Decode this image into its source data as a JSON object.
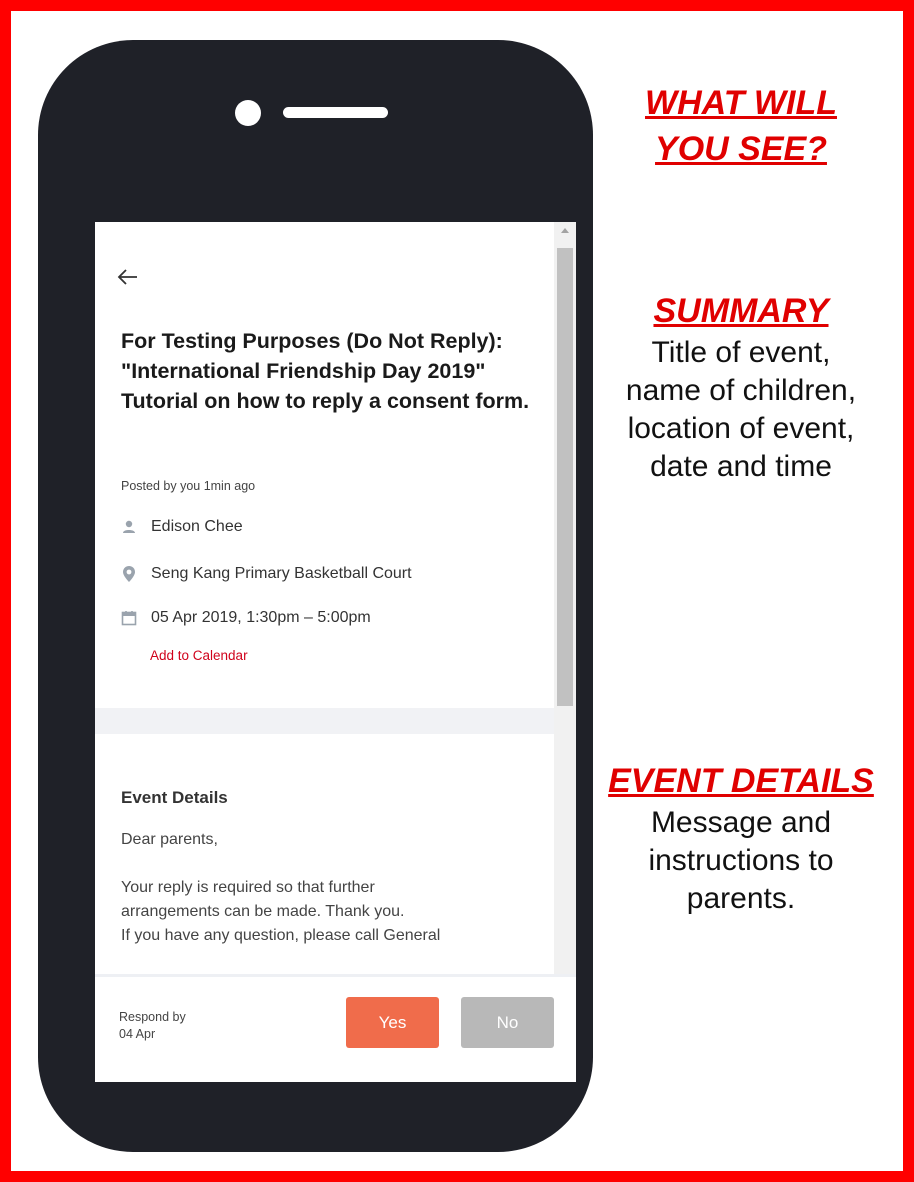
{
  "post": {
    "title": "For Testing Purposes (Do Not Reply): \"International Friendship Day 2019\" Tutorial on how to reply a consent form.",
    "posted": "Posted by you 1min ago",
    "child_name": "Edison Chee",
    "location": "Seng Kang Primary Basketball Court",
    "datetime": "05 Apr 2019, 1:30pm – 5:00pm",
    "add_to_calendar": "Add to Calendar"
  },
  "event_details": {
    "heading": "Event Details",
    "greeting": "Dear parents,",
    "line1": "Your reply is required so that further",
    "line2": "arrangements can be made. Thank you.",
    "line3": "If you have any question, please call General"
  },
  "footer": {
    "respond_label": "Respond by",
    "respond_date": "04 Apr",
    "yes_label": "Yes",
    "no_label": "No"
  },
  "annotations": {
    "intro_line1": "WHAT WILL",
    "intro_line2": "YOU SEE?",
    "summary_heading": "SUMMARY",
    "summary_l1": "Title of event,",
    "summary_l2": "name of children,",
    "summary_l3": "location of event,",
    "summary_l4": "date and time",
    "details_heading": "EVENT DETAILS",
    "details_l1": "Message and",
    "details_l2": "instructions to",
    "details_l3": "parents."
  },
  "icons": {
    "back": "arrow-left-icon",
    "person": "person-icon",
    "location": "location-pin-icon",
    "calendar": "calendar-icon"
  },
  "colors": {
    "frame_border": "#ff0000",
    "heading_red": "#e00000",
    "phone_body": "#1f2128",
    "yes_button": "#f06c4b",
    "no_button": "#b8b8b8",
    "link_red": "#d0021b"
  }
}
